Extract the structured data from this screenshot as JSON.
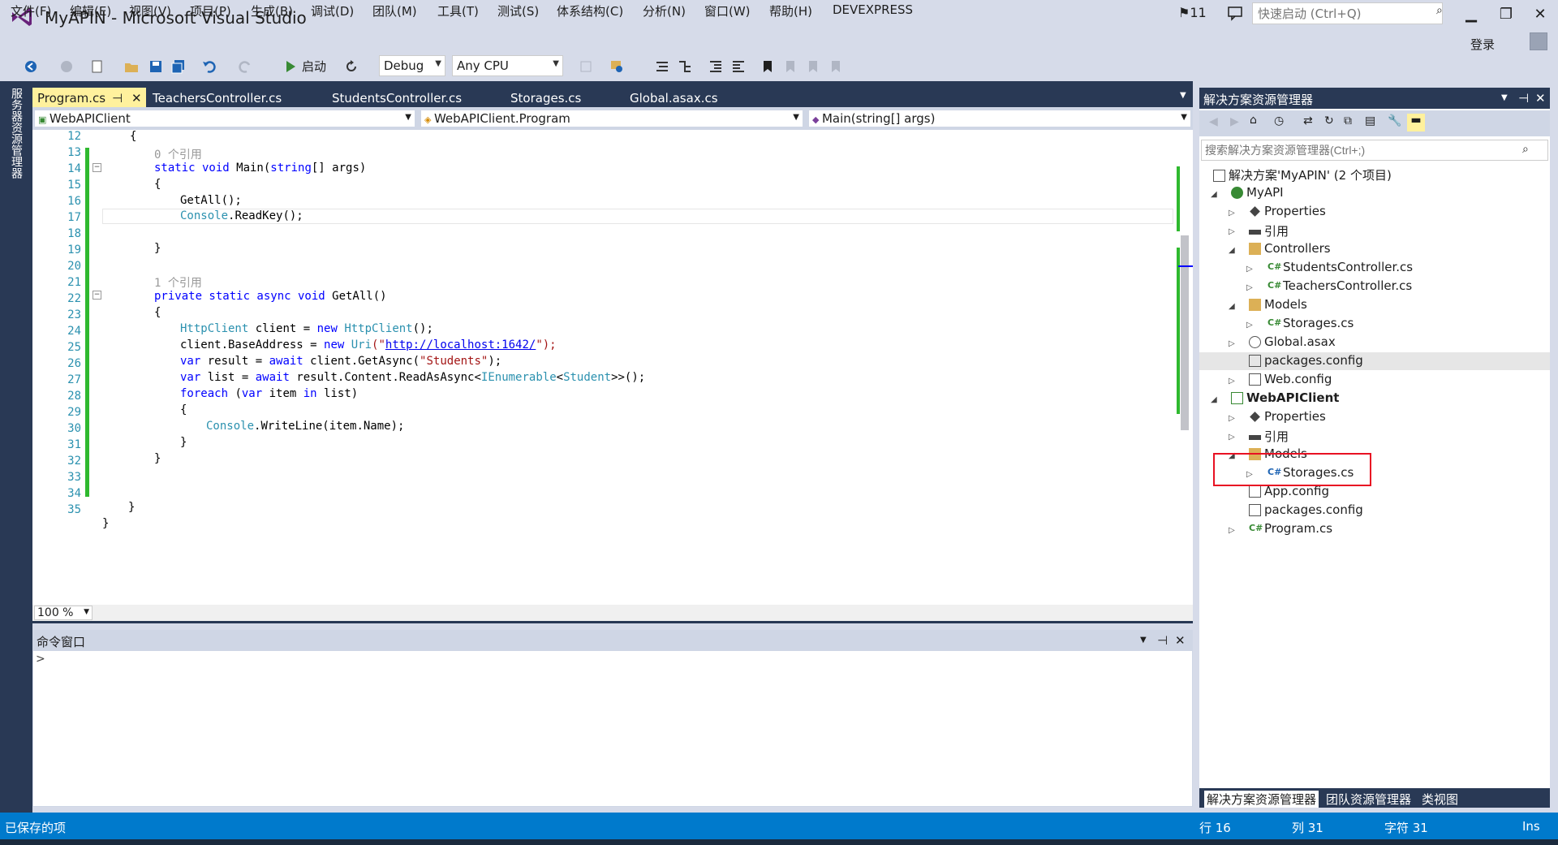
{
  "window": {
    "title": "MyAPIN - Microsoft Visual Studio",
    "notification_count": "11",
    "quick_launch_placeholder": "快速启动 (Ctrl+Q)",
    "login": "登录"
  },
  "menu": [
    "文件(F)",
    "编辑(E)",
    "视图(V)",
    "项目(P)",
    "生成(B)",
    "调试(D)",
    "团队(M)",
    "工具(T)",
    "测试(S)",
    "体系结构(C)",
    "分析(N)",
    "窗口(W)",
    "帮助(H)",
    "DEVEXPRESS"
  ],
  "toolbar": {
    "start_label": "启动",
    "config": "Debug",
    "platform": "Any CPU"
  },
  "left_tab": "服务器资源管理器",
  "tabs": [
    {
      "label": "Program.cs",
      "active": true
    },
    {
      "label": "TeachersController.cs",
      "active": false
    },
    {
      "label": "StudentsController.cs",
      "active": false
    },
    {
      "label": "Storages.cs",
      "active": false
    },
    {
      "label": "Global.asax.cs",
      "active": false
    }
  ],
  "nav": {
    "project": "WebAPIClient",
    "class": "WebAPIClient.Program",
    "member": "Main(string[] args)"
  },
  "code": {
    "line_numbers": [
      "12",
      "13",
      "14",
      "15",
      "16",
      "17",
      "18",
      "19",
      "20",
      "21",
      "22",
      "23",
      "24",
      "25",
      "26",
      "27",
      "28",
      "29",
      "30",
      "31",
      "32",
      "33",
      "34",
      "35"
    ],
    "ref0": "0 个引用",
    "ref1": "1 个引用",
    "l12": "{",
    "l13a": "static void",
    "l13b": " Main(",
    "l13c": "string",
    "l13d": "[] args)",
    "l14": "{",
    "l15": "GetAll();",
    "l16a": "Console",
    "l16b": ".ReadKey();",
    "l18": "}",
    "l20a": "private static async void",
    "l20b": " GetAll()",
    "l21": "{",
    "l22a": "HttpClient",
    "l22b": " client = ",
    "l22c": "new",
    "l22d": " HttpClient",
    "l22e": "();",
    "l23a": "client.BaseAddress = ",
    "l23b": "new",
    "l23c": " Uri",
    "l23d": "(\"",
    "l23e": "http://localhost:1642/",
    "l23f": "\");",
    "l24a": "var",
    "l24b": " result = ",
    "l24c": "await",
    "l24d": " client.GetAsync(",
    "l24e": "\"Students\"",
    "l24f": ");",
    "l25a": "var",
    "l25b": " list = ",
    "l25c": "await",
    "l25d": " result.Content.ReadAsAsync<",
    "l25e": "IEnumerable",
    "l25f": "<",
    "l25g": "Student",
    "l25h": ">>();",
    "l26a": "foreach",
    "l26b": " (",
    "l26c": "var",
    "l26d": " item ",
    "l26e": "in",
    "l26f": " list)",
    "l27": "{",
    "l28a": "Console",
    "l28b": ".WriteLine(item.Name);",
    "l29": "}",
    "l30": "}",
    "l33": "}",
    "l34": "}"
  },
  "zoom": "100 %",
  "command_window": {
    "title": "命令窗口",
    "prompt": ">"
  },
  "solution_explorer": {
    "title": "解决方案资源管理器",
    "search_placeholder": "搜索解决方案资源管理器(Ctrl+;)",
    "solution": "解决方案'MyAPIN' (2 个项目)",
    "items": [
      {
        "label": "MyAPI",
        "level": 1,
        "bold": false
      },
      {
        "label": "Properties",
        "level": 2
      },
      {
        "label": "引用",
        "level": 2
      },
      {
        "label": "Controllers",
        "level": 2
      },
      {
        "label": "StudentsController.cs",
        "level": 3
      },
      {
        "label": "TeachersController.cs",
        "level": 3
      },
      {
        "label": "Models",
        "level": 2
      },
      {
        "label": "Storages.cs",
        "level": 3
      },
      {
        "label": "Global.asax",
        "level": 2
      },
      {
        "label": "packages.config",
        "level": 2
      },
      {
        "label": "Web.config",
        "level": 2
      },
      {
        "label": "WebAPIClient",
        "level": 1,
        "bold": true
      },
      {
        "label": "Properties",
        "level": 2
      },
      {
        "label": "引用",
        "level": 2
      },
      {
        "label": "Models",
        "level": 2
      },
      {
        "label": "Storages.cs",
        "level": 3
      },
      {
        "label": "App.config",
        "level": 2
      },
      {
        "label": "packages.config",
        "level": 2
      },
      {
        "label": "Program.cs",
        "level": 2
      }
    ],
    "bottom_tabs": [
      "解决方案资源管理器",
      "团队资源管理器",
      "类视图"
    ]
  },
  "status": {
    "message": "已保存的项",
    "row": "行 16",
    "col": "列 31",
    "char": "字符 31",
    "mode": "Ins"
  },
  "colors": {
    "accent": "#007acc",
    "chrome": "#293955",
    "active_tab": "#fff19d",
    "change_bar": "#2fb92f"
  }
}
